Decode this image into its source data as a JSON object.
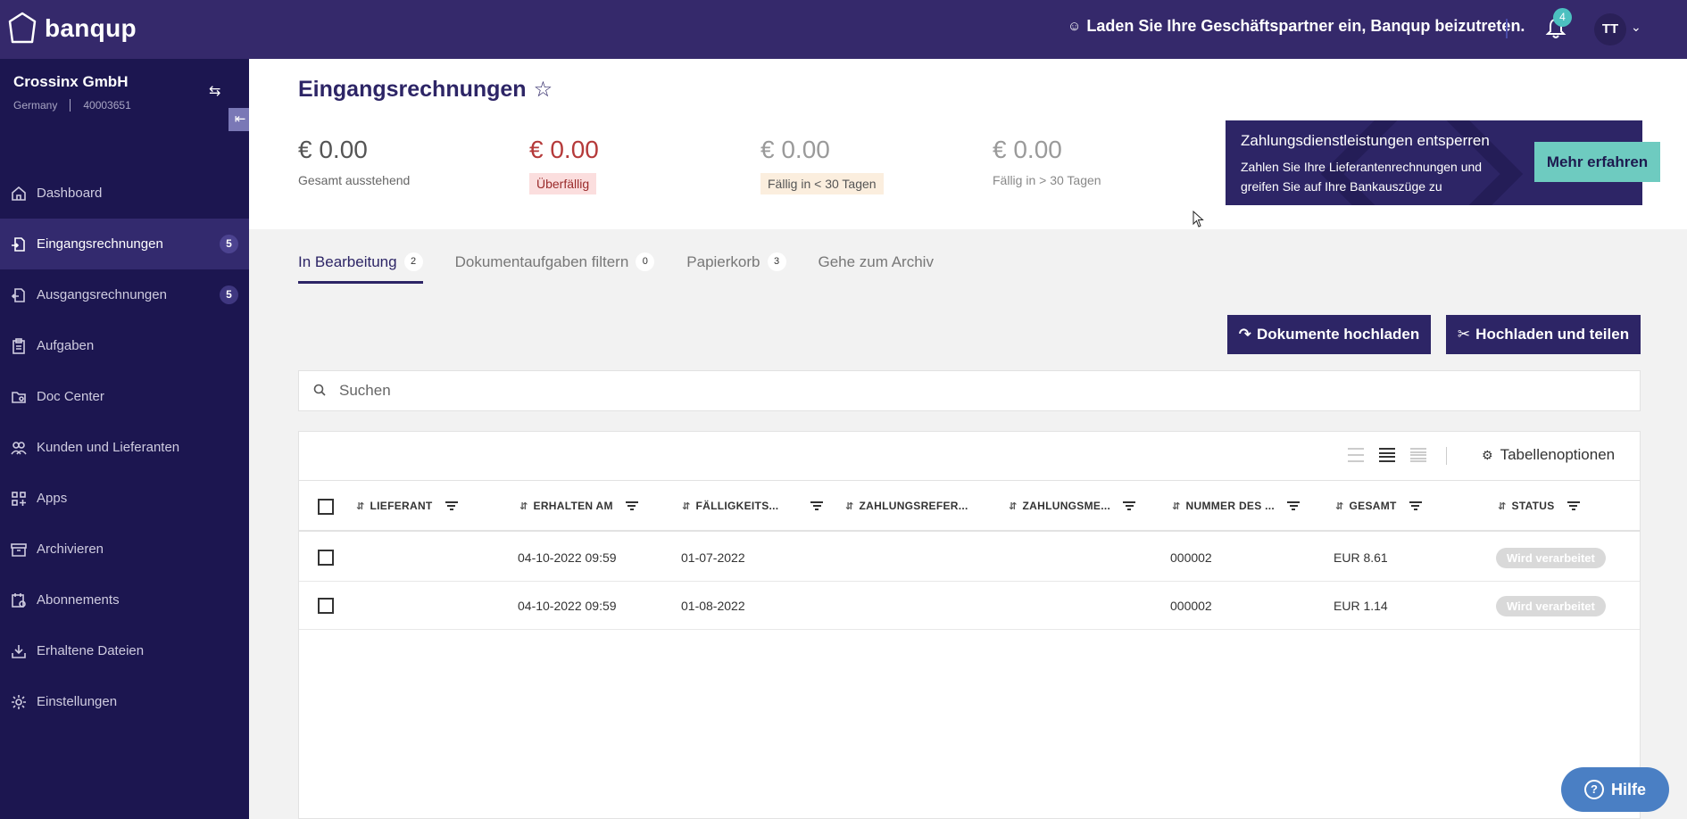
{
  "topbar": {
    "logo_text": "banqup",
    "invite_text": "Laden Sie Ihre Geschäftspartner ein, Banqup beizutreten.",
    "notifications_count": "4",
    "user_initials": "TT"
  },
  "sidebar": {
    "company_name": "Crossinx GmbH",
    "company_country": "Germany",
    "company_id": "40003651",
    "items": [
      {
        "label": "Dashboard",
        "icon": "home-icon",
        "badge": ""
      },
      {
        "label": "Eingangsrechnungen",
        "icon": "incoming-invoice-icon",
        "badge": "5",
        "active": true
      },
      {
        "label": "Ausgangsrechnungen",
        "icon": "outgoing-invoice-icon",
        "badge": "5"
      },
      {
        "label": "Aufgaben",
        "icon": "clipboard-icon",
        "badge": ""
      },
      {
        "label": "Doc Center",
        "icon": "doc-center-icon",
        "badge": ""
      },
      {
        "label": "Kunden und Lieferanten",
        "icon": "people-icon",
        "badge": ""
      },
      {
        "label": "Apps",
        "icon": "apps-icon",
        "badge": ""
      },
      {
        "label": "Archivieren",
        "icon": "archive-icon",
        "badge": ""
      },
      {
        "label": "Abonnements",
        "icon": "subscriptions-icon",
        "badge": ""
      },
      {
        "label": "Erhaltene Dateien",
        "icon": "download-tray-icon",
        "badge": ""
      },
      {
        "label": "Einstellungen",
        "icon": "gear-icon",
        "badge": ""
      }
    ]
  },
  "header": {
    "title": "Eingangsrechnungen",
    "kpis": [
      {
        "amount": "€ 0.00",
        "label": "Gesamt ausstehend"
      },
      {
        "amount": "€ 0.00",
        "label": "Überfällig"
      },
      {
        "amount": "€ 0.00",
        "label": "Fällig in < 30 Tagen"
      },
      {
        "amount": "€ 0.00",
        "label": "Fällig in > 30 Tagen"
      }
    ],
    "promo": {
      "title": "Zahlungsdienstleistungen entsperren",
      "text": "Zahlen Sie Ihre Lieferantenrechnungen und greifen Sie auf Ihre Bankauszüge zu",
      "button": "Mehr erfahren"
    }
  },
  "tabs": [
    {
      "label": "In Bearbeitung",
      "badge": "2"
    },
    {
      "label": "Dokumentaufgaben filtern",
      "badge": "0"
    },
    {
      "label": "Papierkorb",
      "badge": "3"
    },
    {
      "label": "Gehe zum Archiv",
      "badge": ""
    }
  ],
  "actions": {
    "upload": "Dokumente hochladen",
    "split": "Hochladen und teilen"
  },
  "search": {
    "placeholder": "Suchen"
  },
  "table": {
    "options_label": "Tabellenoptionen",
    "columns": [
      "LIEFERANT",
      "ERHALTEN AM",
      "FÄLLIGKEITS...",
      "ZAHLUNGSREFER...",
      "ZAHLUNGSME...",
      "NUMMER DES ...",
      "GESAMT",
      "STATUS"
    ],
    "rows": [
      {
        "supplier": "",
        "received": "04-10-2022 09:59",
        "due": "01-07-2022",
        "payref": "",
        "paymethod": "",
        "number": "000002",
        "total": "EUR 8.61",
        "status": "Wird verarbeitet"
      },
      {
        "supplier": "",
        "received": "04-10-2022 09:59",
        "due": "01-08-2022",
        "payref": "",
        "paymethod": "",
        "number": "000002",
        "total": "EUR 1.14",
        "status": "Wird verarbeitet"
      }
    ]
  },
  "help": {
    "label": "Hilfe"
  },
  "colors": {
    "topbar": "#35296b",
    "sidebar": "#1c1650",
    "accent": "#2d2566",
    "teal": "#6ecbc0",
    "help": "#4a7fc4"
  }
}
